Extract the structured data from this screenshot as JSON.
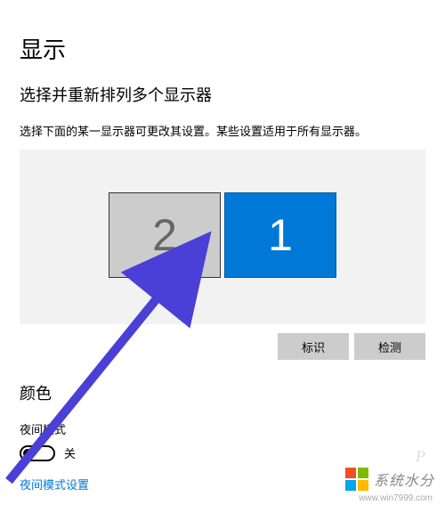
{
  "page": {
    "title": "显示",
    "section_title": "选择并重新排列多个显示器",
    "description": "选择下面的某一显示器可更改其设置。某些设置适用于所有显示器。"
  },
  "monitors": {
    "monitor2_label": "2",
    "monitor1_label": "1"
  },
  "buttons": {
    "identify": "标识",
    "detect": "检测"
  },
  "color": {
    "section_title": "颜色",
    "night_mode_label": "夜间模式",
    "toggle_state": "关",
    "settings_link": "夜间模式设置"
  },
  "watermark": {
    "text": "系统水分",
    "url": "www.win7999.com",
    "p": "P"
  }
}
